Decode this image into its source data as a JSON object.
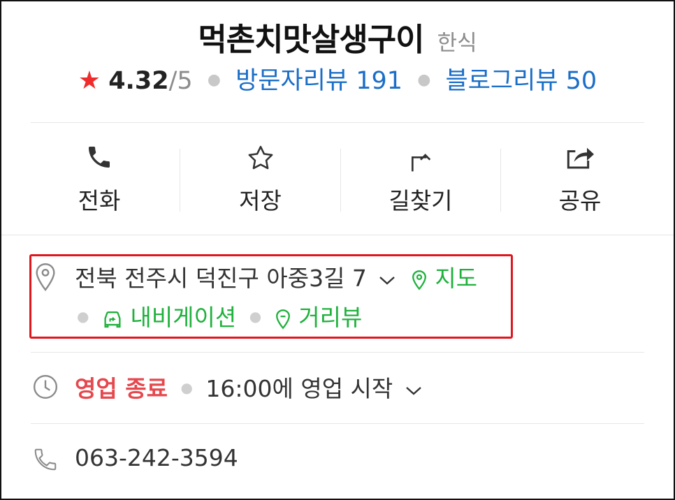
{
  "place": {
    "name": "먹촌치맛살생구이",
    "category": "한식"
  },
  "rating": {
    "star_glyph": "★",
    "score": "4.32",
    "max": "/5",
    "visitor_reviews_label": "방문자리뷰 191",
    "blog_reviews_label": "블로그리뷰 50"
  },
  "actions": [
    {
      "label": "전화",
      "icon": "phone-icon"
    },
    {
      "label": "저장",
      "icon": "star-outline-icon"
    },
    {
      "label": "길찾기",
      "icon": "directions-arrow-icon"
    },
    {
      "label": "공유",
      "icon": "share-icon"
    }
  ],
  "address": {
    "text": "전북 전주시 덕진구 아중3길 7",
    "map_label": "지도",
    "navigation_label": "내비게이션",
    "street_view_label": "거리뷰"
  },
  "hours": {
    "status": "영업 종료",
    "next_open": "16:00에 영업 시작"
  },
  "phone": {
    "number": "063-242-3594"
  },
  "colors": {
    "star": "#f02b2b",
    "link_blue": "#1a6ec8",
    "green": "#1fb13c",
    "closed_red": "#e5484d",
    "highlight_border": "#e0161e"
  }
}
